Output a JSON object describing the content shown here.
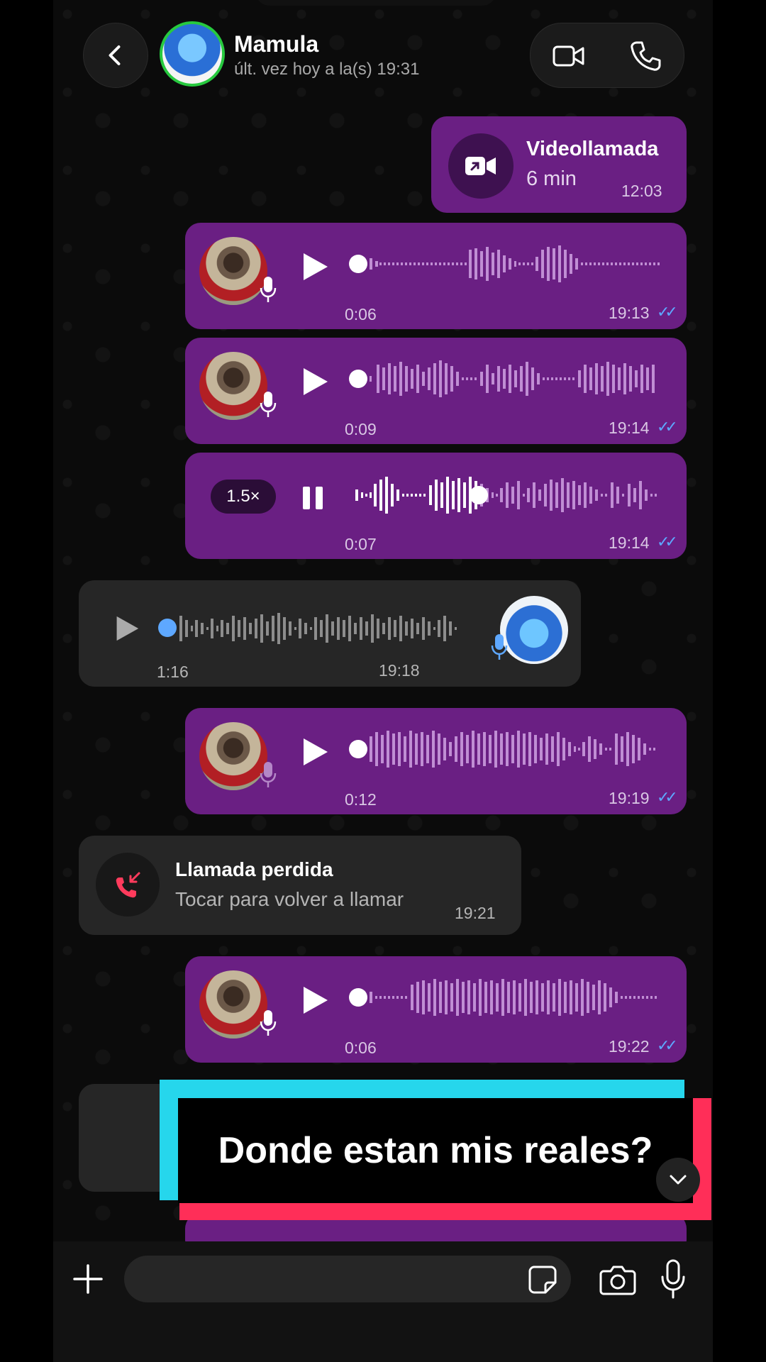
{
  "header": {
    "contact_name": "Mamula",
    "status": "últ. vez hoy a la(s) 19:31"
  },
  "messages": [
    {
      "type": "videocall",
      "title": "Videollamada",
      "duration": "6 min",
      "time": "12:03"
    },
    {
      "type": "voice",
      "duration": "0:06",
      "time": "19:13",
      "read": true
    },
    {
      "type": "voice",
      "duration": "0:09",
      "time": "19:14",
      "read": true
    },
    {
      "type": "voice_playing",
      "speed": "1.5×",
      "duration": "0:07",
      "time": "19:14",
      "read": true
    },
    {
      "type": "voice_incoming",
      "duration": "1:16",
      "time": "19:18"
    },
    {
      "type": "voice",
      "duration": "0:12",
      "time": "19:19",
      "read": true
    },
    {
      "type": "missed_call",
      "title": "Llamada perdida",
      "subtitle": "Tocar para volver a llamar",
      "time": "19:21"
    },
    {
      "type": "voice",
      "duration": "0:06",
      "time": "19:22",
      "read": true
    }
  ],
  "read_ticks": "✓✓",
  "caption": "Donde estan mis reales?",
  "input": {
    "placeholder": ""
  },
  "colors": {
    "outgoing_bubble": "#6a1f83",
    "incoming_bubble": "#262626",
    "read_ticks": "#5ea8ff",
    "online_ring": "#27c93f",
    "caption_cyan": "#26d6ec",
    "caption_red": "#ff2e58",
    "missed_call_red": "#ff3b5c"
  },
  "icons": [
    "back-icon",
    "video-camera-icon",
    "phone-icon",
    "video-call-icon",
    "microphone-icon",
    "play-icon",
    "pause-icon",
    "missed-call-icon",
    "chevron-down-icon",
    "plus-icon",
    "sticker-icon",
    "camera-icon"
  ]
}
